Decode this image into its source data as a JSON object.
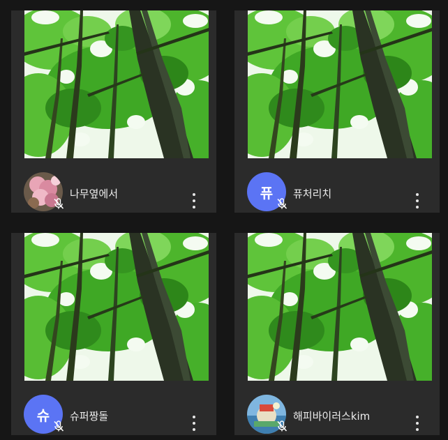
{
  "participants": [
    {
      "name": "나무옆에서",
      "avatar_type": "photo",
      "avatar_theme": "pink-flowers",
      "mic_status": "muted",
      "video": "forest-canopy"
    },
    {
      "name": "퓨처리치",
      "avatar_type": "letter",
      "avatar_letter": "퓨",
      "avatar_color": "#5b74f4",
      "mic_status": "muted",
      "video": "forest-canopy"
    },
    {
      "name": "슈퍼짱돌",
      "avatar_type": "letter",
      "avatar_letter": "슈",
      "avatar_color": "#5b74f4",
      "mic_status": "muted",
      "video": "forest-canopy"
    },
    {
      "name": "해피바이러스kim",
      "avatar_type": "photo",
      "avatar_theme": "sky-scene",
      "mic_status": "muted",
      "video": "forest-canopy"
    }
  ],
  "icons": {
    "mic": "mic-off-icon",
    "menu": "more-vertical-icon"
  }
}
